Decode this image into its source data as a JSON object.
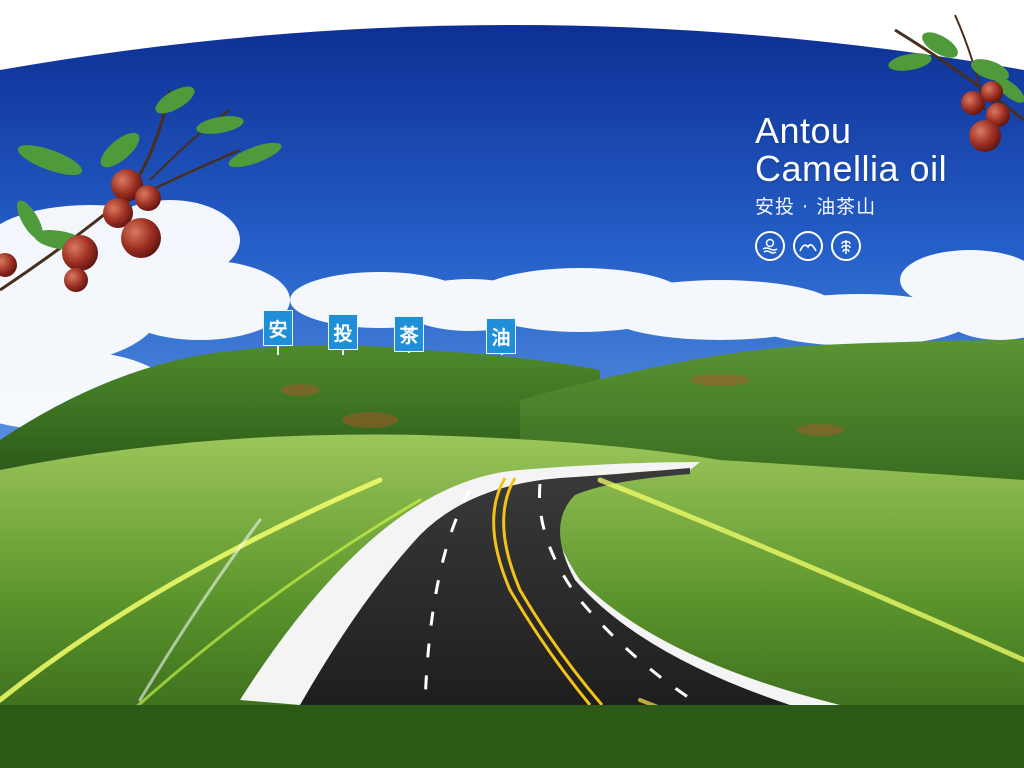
{
  "brand": {
    "title_line1": "Antou",
    "title_line2": "Camellia oil",
    "subtitle": "安投 · 油茶山",
    "icons": [
      "sun-water-icon",
      "mountain-icon",
      "grain-icon"
    ]
  },
  "signs": [
    "安",
    "投",
    "茶",
    "油"
  ],
  "colors": {
    "sky_top": "#0a2a8a",
    "sky_bottom": "#3c78d8",
    "hill_green": "#3f7d28",
    "grass": "#6fa33a",
    "road": "#2a2a2a",
    "road_line_yellow": "#f2c316",
    "sign_blue": "#1e8fd8"
  }
}
